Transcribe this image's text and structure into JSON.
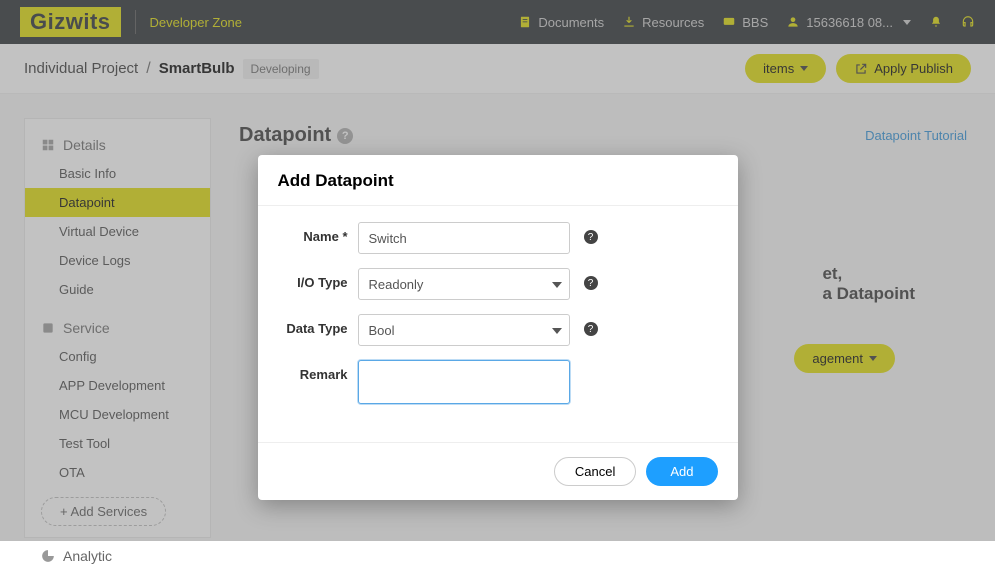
{
  "topbar": {
    "logo": "Gizwits",
    "zone": "Developer Zone",
    "links": {
      "documents": "Documents",
      "resources": "Resources",
      "bbs": "BBS",
      "user": "15636618 08..."
    }
  },
  "breadcrumb": {
    "parent": "Individual Project",
    "current": "SmartBulb",
    "status": "Developing",
    "items_btn": "items",
    "apply_publish": "Apply Publish"
  },
  "sidebar": {
    "groups": [
      {
        "title": "Details",
        "items": [
          "Basic Info",
          "Datapoint",
          "Virtual Device",
          "Device Logs",
          "Guide"
        ],
        "active": 1
      },
      {
        "title": "Service",
        "items": [
          "Config",
          "APP Development",
          "MCU Development",
          "Test Tool",
          "OTA"
        ]
      },
      {
        "title": "Analytic",
        "items": []
      }
    ],
    "add_services": "+ Add Services"
  },
  "content": {
    "title": "Datapoint",
    "tutorial_link": "Datapoint Tutorial",
    "bg_line1": "et,",
    "bg_line2": "a Datapoint",
    "bg_btn": "agement"
  },
  "modal": {
    "title": "Add Datapoint",
    "labels": {
      "name": "Name *",
      "io": "I/O Type",
      "dtype": "Data Type",
      "remark": "Remark"
    },
    "values": {
      "name": "Switch",
      "io": "Readonly",
      "dtype": "Bool",
      "remark": ""
    },
    "buttons": {
      "cancel": "Cancel",
      "add": "Add"
    }
  }
}
